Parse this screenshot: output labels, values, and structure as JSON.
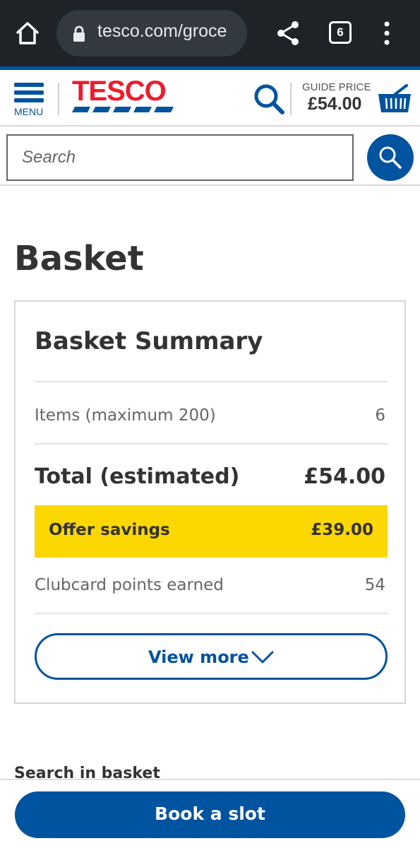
{
  "browser": {
    "url": "tesco.com/groce",
    "tab_count": "6"
  },
  "header": {
    "menu_label": "MENU",
    "logo_text": "TESCO",
    "guide_label": "GUIDE PRICE",
    "guide_price": "£54.00"
  },
  "search": {
    "placeholder": "Search"
  },
  "page": {
    "title": "Basket"
  },
  "summary": {
    "title": "Basket Summary",
    "items_label": "Items (maximum 200)",
    "items_value": "6",
    "total_label": "Total (estimated)",
    "total_value": "£54.00",
    "offer_label": "Offer savings",
    "offer_value": "£39.00",
    "clubcard_label": "Clubcard points earned",
    "clubcard_value": "54",
    "view_more_label": "View more"
  },
  "section": {
    "search_in_basket": "Search in basket"
  },
  "footer": {
    "book_slot_label": "Book a slot"
  },
  "colors": {
    "brand_blue": "#00539f",
    "brand_red": "#ee1c2e",
    "offer_yellow": "#fcd700",
    "browser_bar": "#1f2327"
  },
  "icons": [
    "home-icon",
    "lock-icon",
    "share-icon",
    "tabs-icon",
    "more-vert-icon",
    "hamburger-menu-icon",
    "search-icon",
    "basket-icon",
    "chevron-down-icon"
  ]
}
